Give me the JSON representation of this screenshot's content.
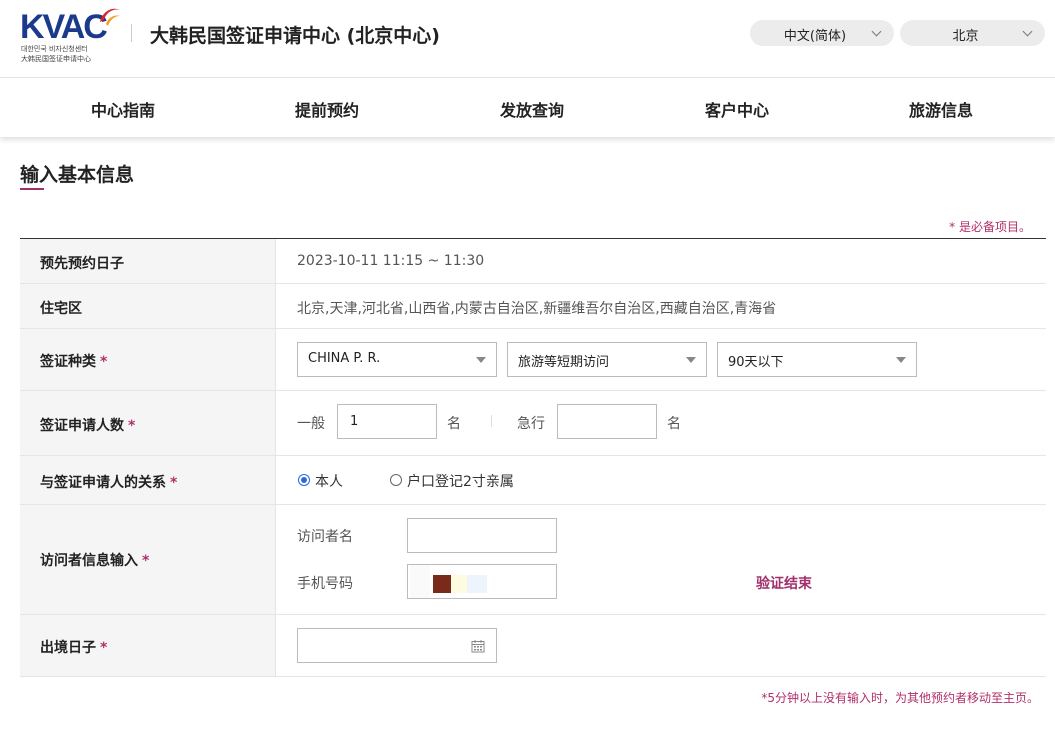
{
  "header": {
    "logo_text": "KVAC",
    "logo_sub_ko": "대한민국 비자신청센터",
    "logo_sub_cn": "大韩民国签证申请中心",
    "site_title": "大韩民国签证申请中心 (北京中心)",
    "language": "中文(简体)",
    "city": "北京"
  },
  "nav": {
    "items": [
      "中心指南",
      "提前预约",
      "发放查询",
      "客户中心",
      "旅游信息"
    ]
  },
  "section": {
    "title": "输入基本信息",
    "required_note": "* 是必备项目。"
  },
  "form": {
    "reservation_date": {
      "label": "预先预约日子",
      "value": "2023-10-11 11:15 ~ 11:30"
    },
    "residence": {
      "label": "住宅区",
      "value": "北京,天津,河北省,山西省,内蒙古自治区,新疆维吾尔自治区,西藏自治区,青海省"
    },
    "visa_type": {
      "label": "签证种类",
      "required": "*",
      "country": "CHINA P. R.",
      "purpose": "旅游等短期访问",
      "duration": "90天以下"
    },
    "applicant_count": {
      "label": "签证申请人数",
      "required": "*",
      "normal_label": "一般",
      "normal_value": "1",
      "unit": "名",
      "urgent_label": "急行",
      "urgent_value": "",
      "urgent_unit": "名"
    },
    "relation": {
      "label": "与签证申请人的关系",
      "required": "*",
      "option_self": "本人",
      "option_family": "户口登记2寸亲属",
      "selected": "本人"
    },
    "visitor_info": {
      "label": "访问者信息输入",
      "required": "*",
      "name_label": "访问者名",
      "name_value": "",
      "phone_label": "手机号码",
      "verify_status": "验证结束"
    },
    "departure_date": {
      "label": "出境日子",
      "required": "*",
      "value": ""
    }
  },
  "footer_note": "*5分钟以上没有输入时，为其他预约者移动至主页。",
  "colors": {
    "accent": "#a0306a",
    "brand": "#1b3a8c",
    "radio": "#2a6ad8"
  },
  "icons": {
    "calendar": "calendar-icon",
    "dropdown": "chevron-down-icon"
  }
}
